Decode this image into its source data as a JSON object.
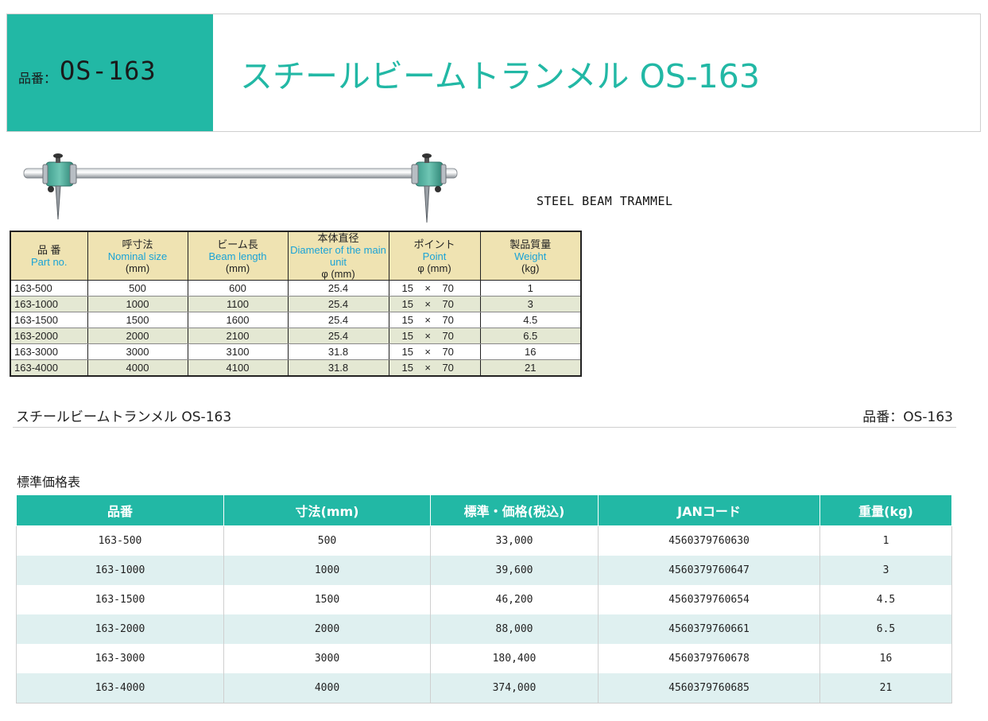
{
  "header": {
    "code_label": "品番：",
    "code_value": "OS-163",
    "title": "スチールビームトランメル OS-163"
  },
  "english_title": "STEEL BEAM TRAMMEL",
  "spec_table": {
    "headers": [
      {
        "ja": "品 番",
        "en": "Part no.",
        "unit": ""
      },
      {
        "ja": "呼寸法",
        "en": "Nominal size",
        "unit": "(mm)"
      },
      {
        "ja": "ビーム長",
        "en": "Beam length",
        "unit": "(mm)"
      },
      {
        "ja": "本体直径",
        "en": "Diameter of the main unit",
        "unit": "φ (mm)"
      },
      {
        "ja": "ポイント",
        "en": "Point",
        "unit": "φ (mm)"
      },
      {
        "ja": "製品質量",
        "en": "Weight",
        "unit": "(kg)"
      }
    ],
    "rows": [
      [
        "163-500",
        "500",
        "600",
        "25.4",
        "15    ×    70",
        "1"
      ],
      [
        "163-1000",
        "1000",
        "1100",
        "25.4",
        "15    ×    70",
        "3"
      ],
      [
        "163-1500",
        "1500",
        "1600",
        "25.4",
        "15    ×    70",
        "4.5"
      ],
      [
        "163-2000",
        "2000",
        "2100",
        "25.4",
        "15    ×    70",
        "6.5"
      ],
      [
        "163-3000",
        "3000",
        "3100",
        "31.8",
        "15    ×    70",
        "16"
      ],
      [
        "163-4000",
        "4000",
        "4100",
        "31.8",
        "15    ×    70",
        "21"
      ]
    ]
  },
  "section": {
    "title": "スチールビームトランメル OS-163",
    "code": "品番：OS-163",
    "price_heading": "標準価格表"
  },
  "price_table": {
    "headers": [
      "品番",
      "寸法(mm)",
      "標準・価格(税込)",
      "JANコード",
      "重量(kg)"
    ],
    "rows": [
      [
        "163-500",
        "500",
        "33,000",
        "4560379760630",
        "1"
      ],
      [
        "163-1000",
        "1000",
        "39,600",
        "4560379760647",
        "3"
      ],
      [
        "163-1500",
        "1500",
        "46,200",
        "4560379760654",
        "4.5"
      ],
      [
        "163-2000",
        "2000",
        "88,000",
        "4560379760661",
        "6.5"
      ],
      [
        "163-3000",
        "3000",
        "180,400",
        "4560379760678",
        "16"
      ],
      [
        "163-4000",
        "4000",
        "374,000",
        "4560379760685",
        "21"
      ]
    ]
  },
  "colors": {
    "accent": "#22b8a5",
    "spec_header": "#efe3b2",
    "spec_alt_row": "#e4e8d3",
    "price_alt_row": "#dff0f0",
    "english_text": "#1aa3d6"
  }
}
